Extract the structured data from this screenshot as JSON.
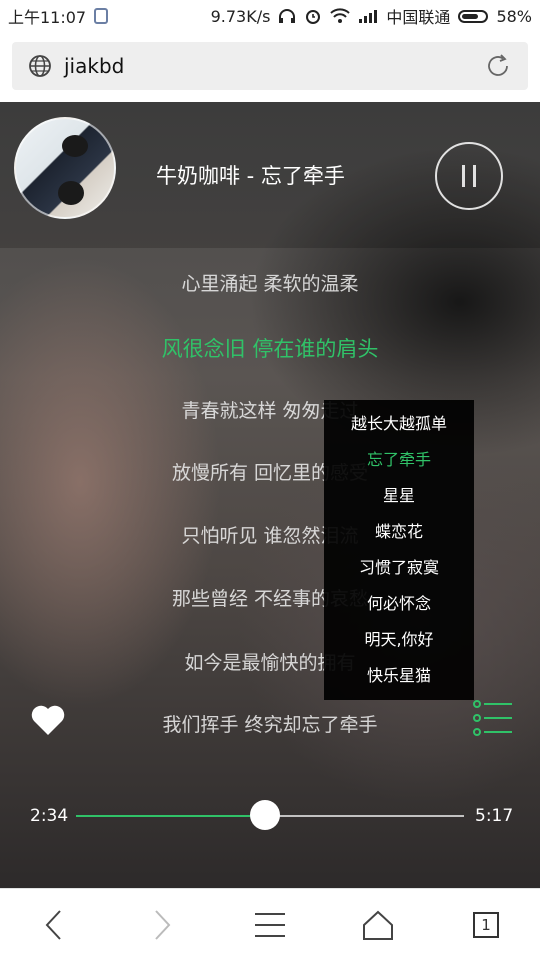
{
  "status_bar": {
    "time": "上午11:07",
    "speed": "9.73K/s",
    "carrier": "中国联通",
    "battery": "58%"
  },
  "address_bar": {
    "url": "jiakbd",
    "icons": [
      "globe-icon",
      "reload-icon"
    ]
  },
  "player": {
    "song_title": "牛奶咖啡 - 忘了牵手",
    "state": "playing",
    "lyrics": [
      {
        "text": "心里涌起 柔软的温柔",
        "active": false
      },
      {
        "text": "风很念旧 停在谁的肩头",
        "active": true
      },
      {
        "text": "青春就这样 匆匆走过",
        "active": false
      },
      {
        "text": "放慢所有 回忆里的感受",
        "active": false
      },
      {
        "text": "只怕听见 谁忽然泪流",
        "active": false
      },
      {
        "text": "那些曾经 不经事的哀愁",
        "active": false
      },
      {
        "text": "如今是最愉快的拥有",
        "active": false
      },
      {
        "text": "我们挥手 终究却忘了牵手",
        "active": false
      }
    ],
    "playlist": [
      {
        "title": "越长大越孤单",
        "active": false
      },
      {
        "title": "忘了牵手",
        "active": true
      },
      {
        "title": "星星",
        "active": false
      },
      {
        "title": "蝶恋花",
        "active": false
      },
      {
        "title": "习惯了寂寞",
        "active": false
      },
      {
        "title": "何必怀念",
        "active": false
      },
      {
        "title": "明天,你好",
        "active": false
      },
      {
        "title": "快乐星猫",
        "active": false
      }
    ],
    "current_time": "2:34",
    "total_time": "5:17",
    "progress_fraction": 0.486,
    "accent_color": "#30c268"
  },
  "bottom_nav": {
    "tab_count": "1",
    "icons": [
      "back-icon",
      "forward-icon",
      "menu-icon",
      "home-icon",
      "tabs-icon"
    ]
  }
}
